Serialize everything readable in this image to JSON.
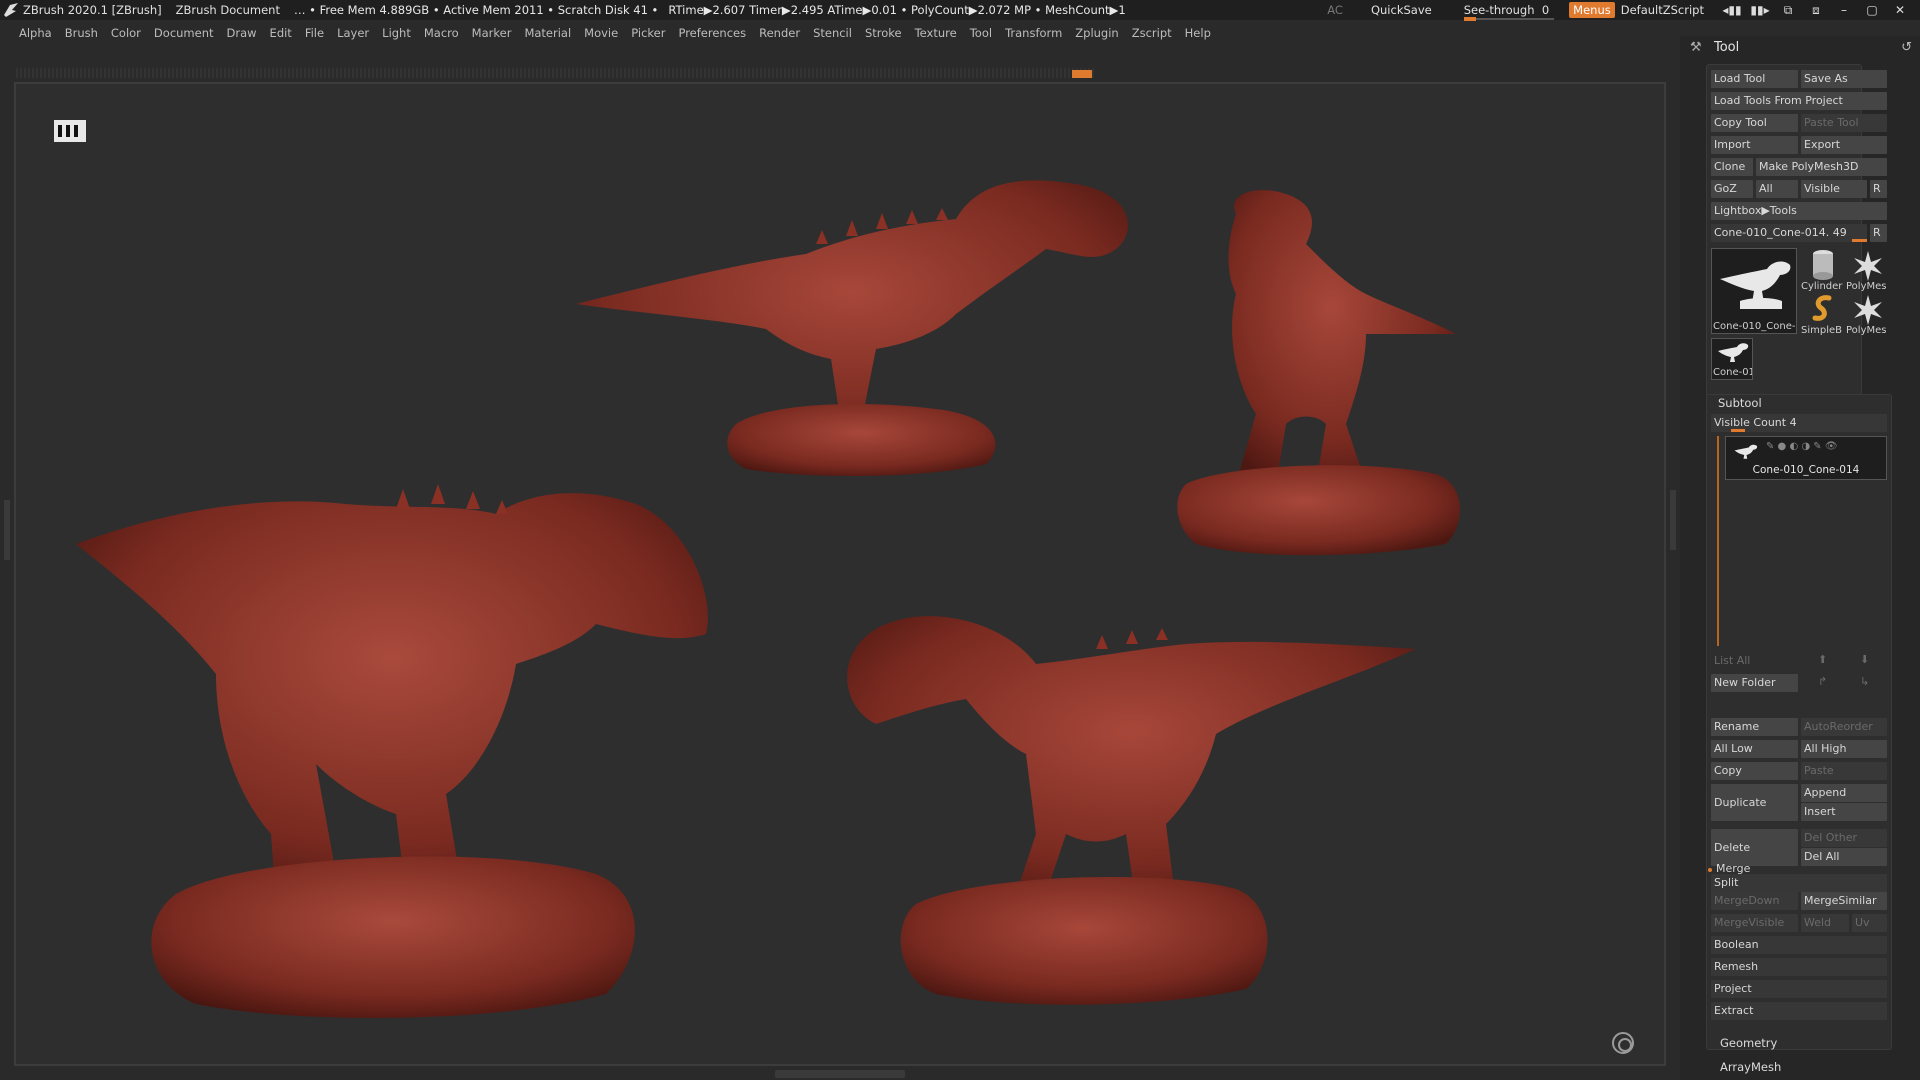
{
  "titlebar": {
    "app": "ZBrush 2020.1 [ZBrush]",
    "document": "ZBrush Document",
    "free_mem": "… • Free Mem 4.889GB • Active Mem 2011 • Scratch Disk 41 •",
    "stats": "RTime▶2.607 Timer▶2.495 ATime▶0.01 • PolyCount▶2.072 MP • MeshCount▶1",
    "ac": "AC",
    "quicksave": "QuickSave",
    "see_through_label": "See-through",
    "see_through_value": "0",
    "menus": "Menus",
    "default_zscript": "DefaultZScript"
  },
  "menubar": [
    "Alpha",
    "Brush",
    "Color",
    "Document",
    "Draw",
    "Edit",
    "File",
    "Layer",
    "Light",
    "Macro",
    "Marker",
    "Material",
    "Movie",
    "Picker",
    "Preferences",
    "Render",
    "Stencil",
    "Stroke",
    "Texture",
    "Tool",
    "Transform",
    "Zplugin",
    "Zscript",
    "Help"
  ],
  "tool": {
    "title": "Tool",
    "load_tool": "Load Tool",
    "save_as": "Save As",
    "load_from_project": "Load Tools From Project",
    "copy_tool": "Copy Tool",
    "paste_tool": "Paste Tool",
    "import": "Import",
    "export": "Export",
    "clone": "Clone",
    "make_polymesh": "Make PolyMesh3D",
    "goz": "GoZ",
    "all": "All",
    "visible": "Visible",
    "r": "R",
    "lightbox_tools": "Lightbox▶Tools",
    "current_tool": "Cone-010_Cone-014. 49",
    "current_tool_slider": 0.85,
    "thumb_main": "Cone-010_Cone-",
    "thumb_cylinder": "Cylinder",
    "thumb_polymesh1": "PolyMes",
    "thumb_simpleb": "SimpleB",
    "thumb_polymesh2": "PolyMes",
    "thumb_cone": "Cone-01"
  },
  "subtool": {
    "title": "Subtool",
    "visible_count": "Visible Count 4",
    "visible_count_slider": 0.15,
    "item_name": "Cone-010_Cone-014",
    "list_all": "List All",
    "new_folder": "New Folder",
    "rename": "Rename",
    "auto_reorder": "AutoReorder",
    "all_low": "All Low",
    "all_high": "All High",
    "copy": "Copy",
    "paste": "Paste",
    "duplicate": "Duplicate",
    "append": "Append",
    "insert": "Insert",
    "delete": "Delete",
    "del_other": "Del Other",
    "del_all": "Del All",
    "split": "Split",
    "merge": "Merge",
    "merge_down": "MergeDown",
    "merge_similar": "MergeSimilar",
    "merge_visible": "MergeVisible",
    "weld": "Weld",
    "uv": "Uv",
    "boolean": "Boolean",
    "remesh": "Remesh",
    "project": "Project",
    "extract": "Extract"
  },
  "sections": {
    "geometry": "Geometry",
    "array_mesh": "ArrayMesh"
  },
  "colors": {
    "accent": "#e07a2e",
    "model": "#8a3024"
  }
}
